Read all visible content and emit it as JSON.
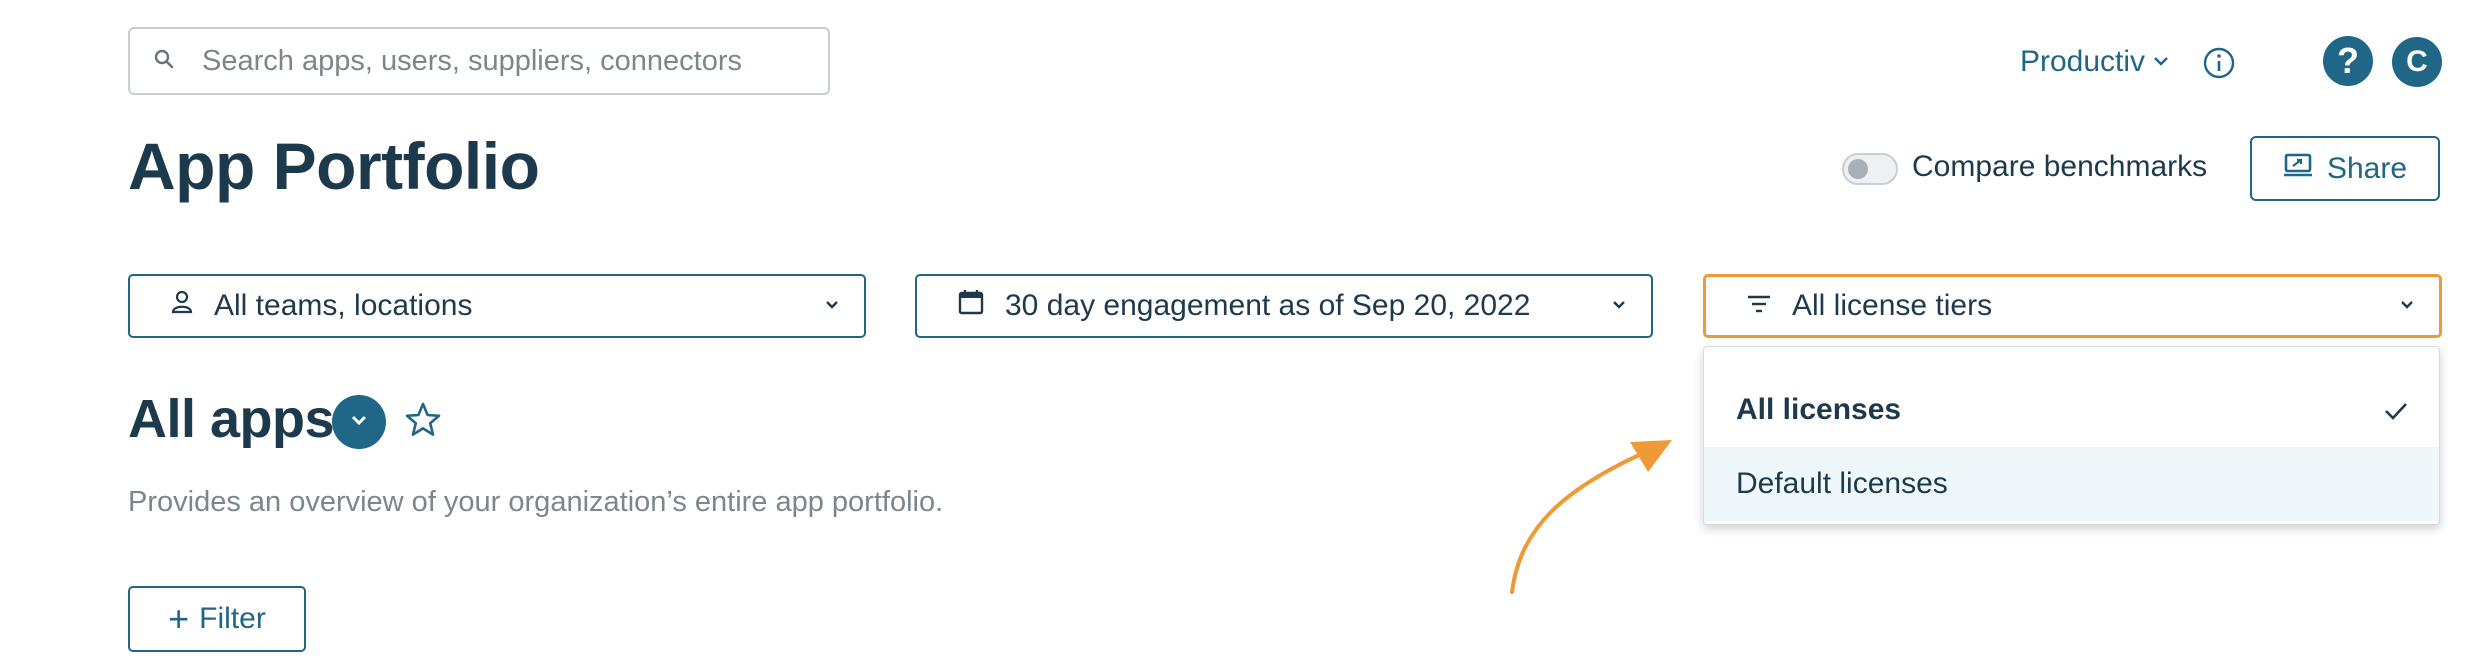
{
  "search": {
    "placeholder": "Search apps, users, suppliers, connectors",
    "icon": "search-icon"
  },
  "header": {
    "org_menu_label": "Productiv",
    "help_label": "?",
    "avatar_initial": "C"
  },
  "page": {
    "title": "App Portfolio",
    "compare_toggle_label": "Compare benchmarks",
    "compare_toggle_on": false,
    "share_label": "Share"
  },
  "filters": {
    "teams": "All teams, locations",
    "date": "30 day engagement as of Sep 20, 2022",
    "license": "All license tiers"
  },
  "license_menu": {
    "items": [
      {
        "label": "All licenses",
        "selected": true
      },
      {
        "label": "Default licenses",
        "selected": false
      }
    ]
  },
  "section": {
    "title": "All apps",
    "description": "Provides an overview of your organization’s entire app portfolio.",
    "filter_label": "Filter"
  },
  "colors": {
    "accent": "#1f6687",
    "text": "#1d3a4c",
    "highlight": "#ef9a36",
    "hover": "#eef8fa",
    "muted": "#7b868f"
  }
}
